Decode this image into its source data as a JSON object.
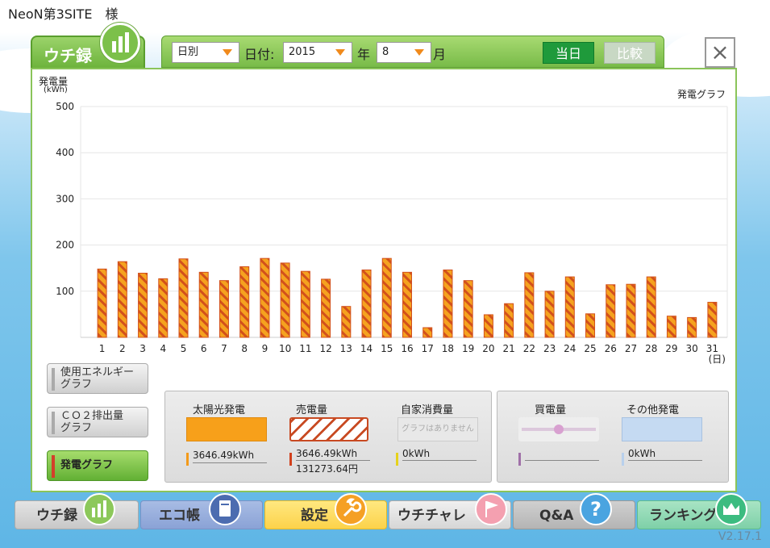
{
  "header": {
    "customer": "NeoN第3SITE　様"
  },
  "brand": {
    "label": "ウチ録"
  },
  "toolbar": {
    "mode": "日別",
    "date_label": "日付:",
    "year": "2015",
    "year_unit": "年",
    "month": "8",
    "month_unit": "月",
    "today_label": "当日",
    "compare_label": "比較"
  },
  "chart_data": {
    "type": "bar",
    "title": "発電グラフ",
    "ylabel": "発電量",
    "yunit": "(kWh)",
    "xunit": "(日)",
    "ylim": [
      0,
      500
    ],
    "yticks": [
      "500",
      "400",
      "300",
      "200",
      "100"
    ],
    "categories": [
      "1",
      "2",
      "3",
      "4",
      "5",
      "6",
      "7",
      "8",
      "9",
      "10",
      "11",
      "12",
      "13",
      "14",
      "15",
      "16",
      "17",
      "18",
      "19",
      "20",
      "21",
      "22",
      "23",
      "24",
      "25",
      "26",
      "27",
      "28",
      "29",
      "30",
      "31"
    ],
    "values": [
      148,
      164,
      139,
      127,
      170,
      141,
      123,
      153,
      171,
      161,
      143,
      126,
      67,
      146,
      171,
      141,
      21,
      146,
      123,
      49,
      73,
      140,
      100,
      131,
      51,
      114,
      115,
      131,
      46,
      43,
      76
    ],
    "colors": {
      "bar": "#f5a21f",
      "stripe": "#d2501c",
      "grid": "#e6e6e6"
    }
  },
  "side_buttons": [
    {
      "line1": "使用エネルギー",
      "line2": "グラフ"
    },
    {
      "line1": "ＣＯ２排出量",
      "line2": "グラフ"
    },
    {
      "line1": "発電グラフ"
    }
  ],
  "legend": {
    "solar": {
      "title": "太陽光発電",
      "value": "3646.49kWh"
    },
    "sold": {
      "title": "売電量",
      "value": "3646.49kWh",
      "price": "131273.64円"
    },
    "self": {
      "title": "自家消費量",
      "note": "グラフはありません",
      "value": "0kWh"
    },
    "bought": {
      "title": "買電量"
    },
    "other": {
      "title": "その他発電",
      "value": "0kWh"
    }
  },
  "nav": {
    "uchiroku": "ウチ録",
    "ecocho": "エコ帳",
    "settei": "設定",
    "uchichare": "ウチチャレ",
    "qa": "Q&A",
    "ranking": "ランキング"
  },
  "version": "V2.17.1"
}
